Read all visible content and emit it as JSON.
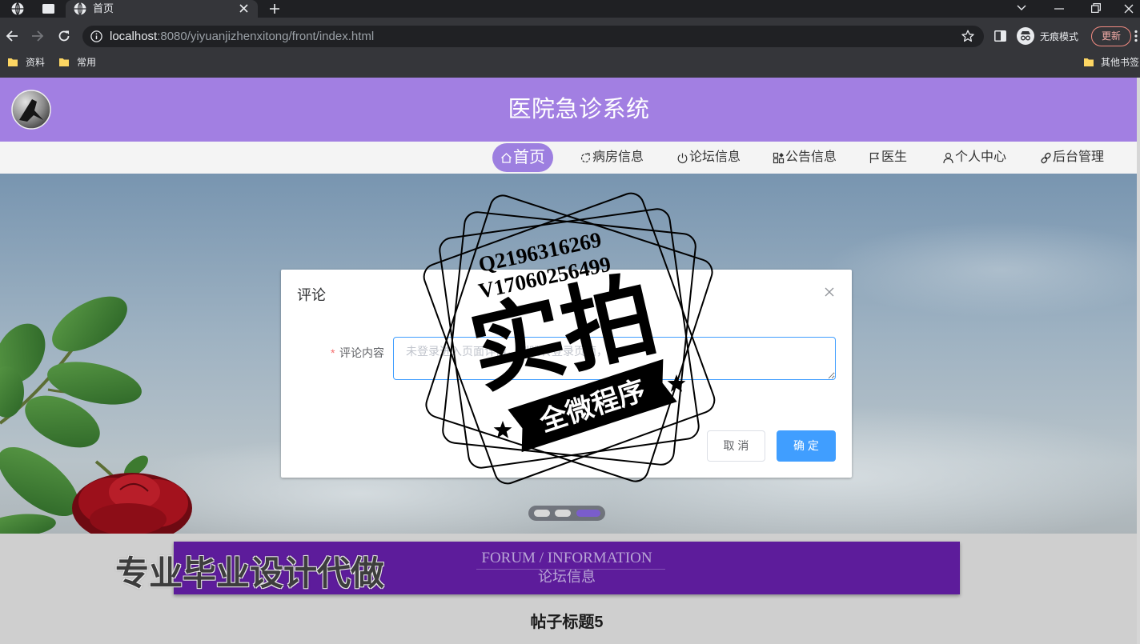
{
  "browser": {
    "tab": {
      "title": "首页",
      "icon": "globe-icon"
    },
    "url": {
      "host": "localhost",
      "rest": ":8080/yiyuanjizhenxitong/front/index.html"
    },
    "profile_label": "无痕模式",
    "update_label": "更新",
    "bookmarks": [
      {
        "label": "资料",
        "icon": "folder-icon"
      },
      {
        "label": "常用",
        "icon": "folder-icon"
      }
    ],
    "other_bookmarks_label": "其他书签"
  },
  "header": {
    "title": "医院急诊系统"
  },
  "nav": {
    "items": [
      {
        "label": "首页",
        "icon": "home-icon",
        "active": true
      },
      {
        "label": "病房信息",
        "icon": "refresh-icon",
        "active": false
      },
      {
        "label": "论坛信息",
        "icon": "power-icon",
        "active": false
      },
      {
        "label": "公告信息",
        "icon": "grid-icon",
        "active": false
      },
      {
        "label": "医生",
        "icon": "flag-icon",
        "active": false
      },
      {
        "label": "个人中心",
        "icon": "user-icon",
        "active": false
      },
      {
        "label": "后台管理",
        "icon": "link-icon",
        "active": false
      }
    ]
  },
  "carousel": {
    "slides": 3,
    "active_slide": 3
  },
  "dialog": {
    "title": "评论",
    "form": {
      "required_mark": "*",
      "label": "评论内容",
      "placeholder": "未登录进入页面详情，则跳转登录页面，",
      "value": ""
    },
    "cancel_label": "取 消",
    "confirm_label": "确 定"
  },
  "section": {
    "title_en": "FORUM / INFORMATION",
    "title_cn": "论坛信息",
    "post_title": "帖子标题5"
  },
  "watermark": {
    "contact_q": "Q2196316269",
    "contact_v": "V17060256499",
    "stamp_title": "实拍",
    "stamp_banner": "全微程序",
    "overlay_text": "专业毕业设计代做"
  },
  "colors": {
    "header_bg": "#a27fe2",
    "nav_active_bg": "#9d7fe0",
    "section_bar_bg": "#5d1c9b",
    "primary_button": "#409eff",
    "required_mark": "#f56c6c",
    "update_border": "#f28b82",
    "carousel_active": "#7a5dcc"
  }
}
